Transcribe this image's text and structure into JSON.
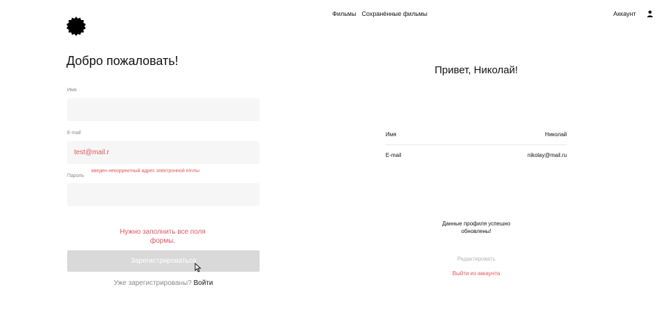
{
  "nav": {
    "movies": "Фильмы",
    "saved_movies": "Сохранённые фильмы",
    "account": "Аккаунт"
  },
  "register": {
    "title": "Добро пожаловать!",
    "name_label": "Имя",
    "name_value": "",
    "email_label": "E-mail",
    "email_value": "test@mail.r",
    "email_error": "введен некорректный адрес электронной почты",
    "password_label": "Пароль",
    "password_value": "",
    "form_error": "Нужно заполнить все поля формы.",
    "submit_label": "Зарегистрироваться",
    "already_text": "Уже зарегистрированы?",
    "login_link": "Войти"
  },
  "profile": {
    "greeting": "Привет, Николай!",
    "name_label": "Имя",
    "name_value": "Николай",
    "email_label": "E-mail",
    "email_value": "nikolay@mail.ru",
    "success_message": "Данные профиля успешно обновлены!",
    "edit_label": "Редактировать",
    "logout_label": "Выйти из аккаунта"
  },
  "colors": {
    "error": "#e0565b",
    "field_bg": "#f6f6f6",
    "button_disabled": "#d9d9d9"
  },
  "icons": {
    "logo": "logo-icon",
    "account": "person-icon",
    "cursor": "mouse-pointer-icon"
  }
}
